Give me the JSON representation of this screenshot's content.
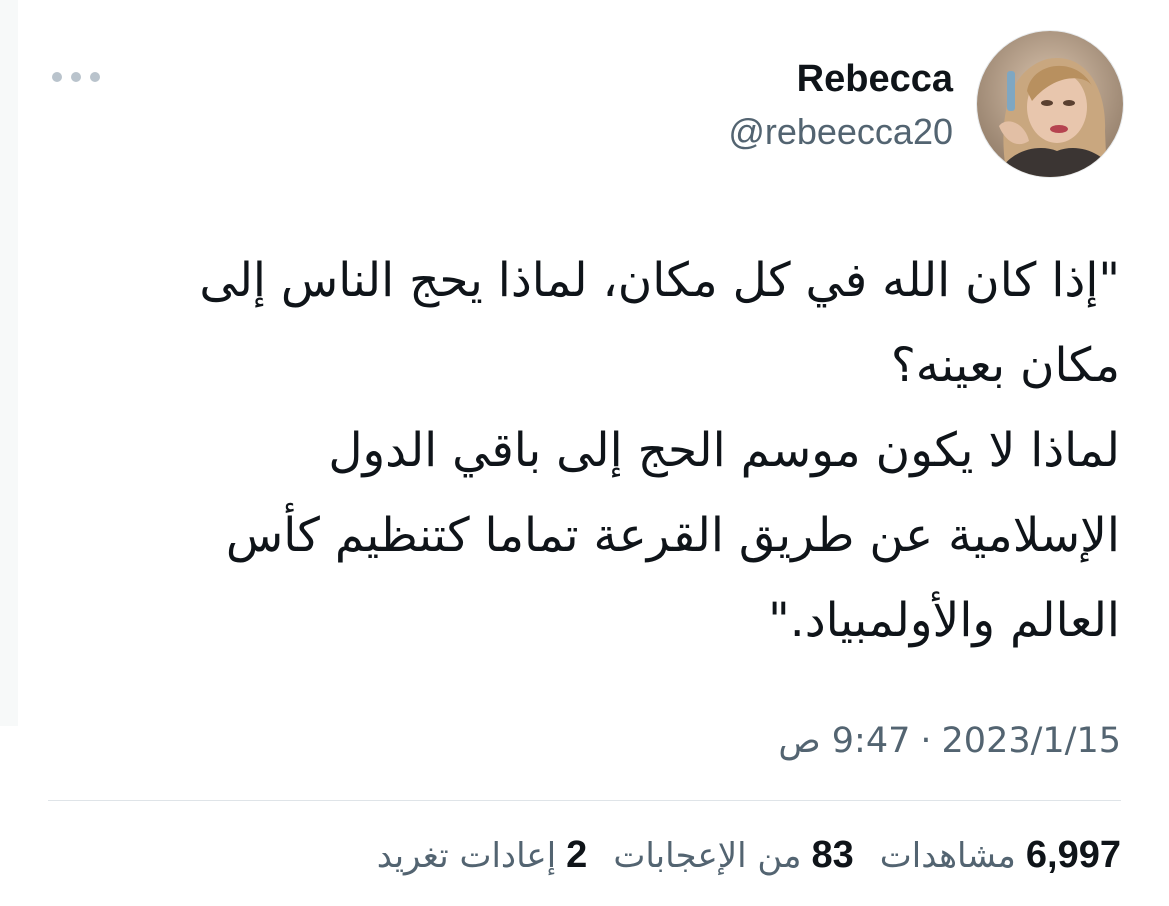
{
  "author": {
    "display_name": "Rebecca",
    "handle": "@rebeecca20"
  },
  "tweet": {
    "lines": [
      "\"إذا كان الله في كل مكان، لماذا يحج الناس إلى",
      "مكان بعينه؟",
      "لماذا لا يكون موسم الحج إلى باقي الدول",
      "الإسلامية عن طريق القرعة تماما كتنظيم كأس",
      "العالم والأولمبياد.\""
    ]
  },
  "meta": {
    "date": "2023/1/15",
    "separator": "·",
    "time": "9:47 ص"
  },
  "stats": {
    "views": {
      "value": "6,997",
      "label": "مشاهدات"
    },
    "likes": {
      "value": "83",
      "label": "من الإعجابات"
    },
    "retweets": {
      "value": "2",
      "label": "إعادات تغريد"
    }
  },
  "icons": {
    "more": "more-horizontal-icon",
    "avatar": "profile-photo"
  },
  "colors": {
    "primary_text": "#0f1419",
    "secondary_text": "#536471",
    "divider": "#dfe4e8",
    "menu_dots": "#b9c3cc"
  }
}
